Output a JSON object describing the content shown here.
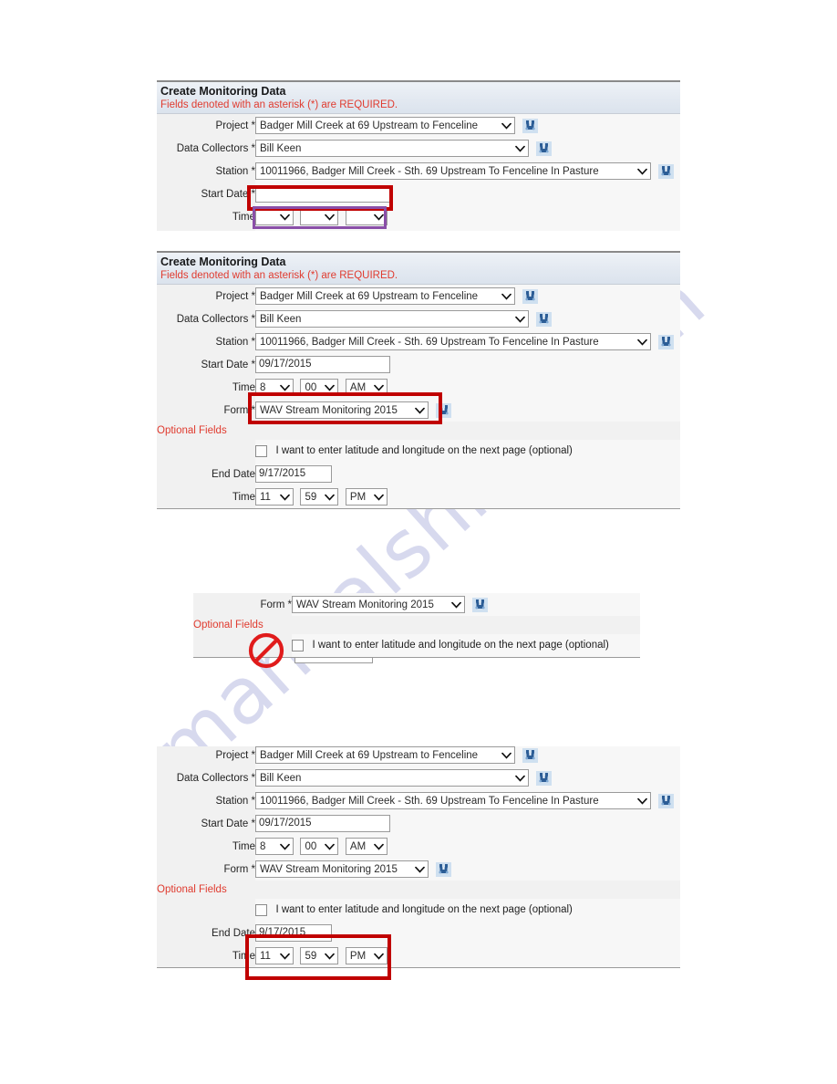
{
  "document": {
    "watermark": "manualshive.com"
  },
  "header": {
    "title": "Create Monitoring Data",
    "required_note": "Fields denoted with an asterisk (*) are REQUIRED."
  },
  "labels": {
    "project": "Project *",
    "data_collectors": "Data Collectors *",
    "station": "Station *",
    "start_date": "Start Date *",
    "time": "Time",
    "form": "Form *",
    "optional_fields": "Optional Fields",
    "end_date": "End Date",
    "end_time": "Time"
  },
  "values": {
    "project": "Badger Mill Creek at 69 Upstream to Fenceline",
    "data_collectors": "Bill Keen",
    "station": "10011966, Badger Mill Creek - Sth. 69 Upstream To Fenceline In Pasture",
    "start_date_empty": "",
    "start_date": "09/17/2015",
    "start_hour_empty": "",
    "start_minute_empty": "",
    "start_ampm_empty": "",
    "start_hour": "8",
    "start_minute": "00",
    "start_ampm": "AM",
    "form": "WAV Stream Monitoring 2015",
    "latlong_checkbox_label": "I want to enter latitude and longitude on the next page (optional)",
    "end_date": "9/17/2015",
    "end_hour": "11",
    "end_minute": "59",
    "end_ampm": "PM"
  },
  "icons": {
    "lookup": "binoculars-icon",
    "caret": "chevron-down-icon",
    "prohibition": "no-entry-icon"
  },
  "colors": {
    "required_text": "#e03b2f",
    "annotation_red": "#c00000",
    "annotation_purple": "#8a4fa8",
    "header_band": "#e3e9f1",
    "label_cell": "#f1f1f1",
    "field_cell": "#f7f7f7",
    "watermark": "#c9cbe8"
  },
  "annotations": {
    "panel1_start_date_box": "red-highlight-start-date",
    "panel1_time_box": "purple-highlight-time",
    "panel2_form_box": "red-highlight-form",
    "panel3_no_checkbox": "no-entry-over-checkbox",
    "panel4_end_datetime_box": "red-highlight-end-date-time"
  }
}
